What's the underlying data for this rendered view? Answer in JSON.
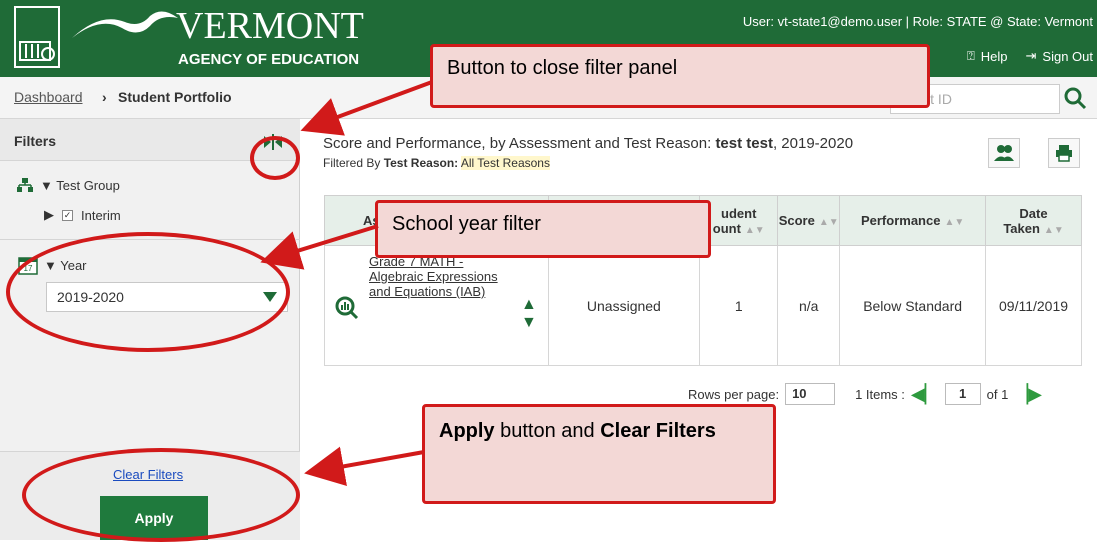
{
  "header": {
    "logo_title": "VERMONT",
    "logo_sub": "AGENCY OF EDUCATION",
    "user_info": "User: vt-state1@demo.user  |  Role: STATE @ State: Vermont",
    "help_label": "Help",
    "signout_label": "Sign Out"
  },
  "breadcrumb": {
    "dashboard": "Dashboard",
    "sep": "›",
    "current": "Student Portfolio"
  },
  "search": {
    "placeholder": "udent ID"
  },
  "sidebar": {
    "title": "Filters",
    "test_group_label": "▼ Test Group",
    "interim_label": "Interim",
    "year_label": "▼ Year",
    "year_value": "2019-2020",
    "calendar_number": "17",
    "clear_filters": "Clear Filters",
    "apply": "Apply"
  },
  "main": {
    "title_pre": "Score and Performance, by Assessment and Test Reason: ",
    "title_student": "test test",
    "title_post": ", 2019-2020",
    "filtered_by": "Filtered By ",
    "test_reason_label": "Test Reason:",
    "test_reason_value": "All Test Reasons"
  },
  "table": {
    "headers": [
      "As",
      "",
      "udent\nount",
      "Score",
      "Performance",
      "Date\nTaken"
    ],
    "row": {
      "assessment": "Grade 7 MATH - Algebraic Expressions and Equations (IAB)",
      "reason": "Unassigned",
      "count": "1",
      "score": "n/a",
      "performance": "Below Standard",
      "date": "09/11/2019"
    }
  },
  "pager": {
    "rows_label": "Rows per page:",
    "rows_value": "10",
    "items_label": "1 Items :",
    "page_value": "1",
    "of_label": "of 1"
  },
  "callouts": {
    "close_filter": "Button to close filter panel",
    "school_year": "School year filter",
    "apply_bold": "Apply",
    "apply_mid": " button and ",
    "clear_bold": "Clear Filters"
  },
  "colors": {
    "brand": "#1f6b37",
    "annotation": "#d11a1a"
  }
}
